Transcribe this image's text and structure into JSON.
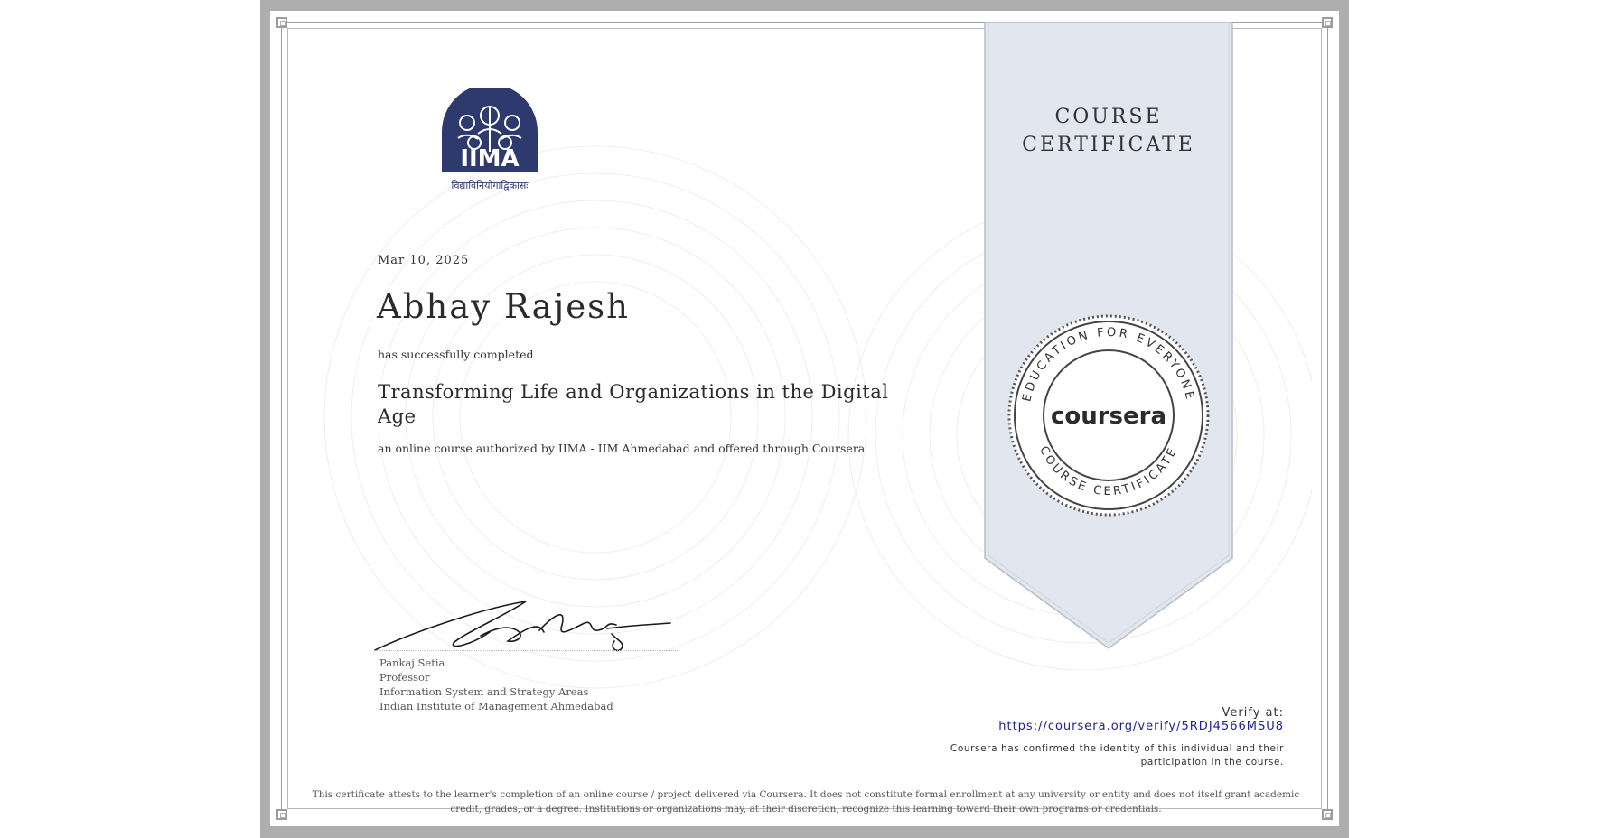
{
  "certificate": {
    "date": "Mar 10, 2025",
    "recipient_name": "Abhay Rajesh",
    "completion_text": "has successfully completed",
    "course_title": "Transforming Life and Organizations in the Digital Age",
    "authorization_text": "an online course authorized by IIMA - IIM Ahmedabad and offered through Coursera"
  },
  "logo": {
    "name": "IIMA",
    "motto": "विद्याविनियोगाद्विकासः",
    "color": "#2e3a6e"
  },
  "ribbon": {
    "title_line1": "COURSE",
    "title_line2": "CERTIFICATE",
    "color": "#e2e6ee"
  },
  "seal": {
    "brand": "coursera",
    "ring_top_text": "EDUCATION FOR EVERYONE",
    "ring_bottom_text": "COURSE CERTIFICATE"
  },
  "signatory": {
    "name": "Pankaj Setia",
    "title": "Professor",
    "department": "Information System and Strategy Areas",
    "institution": "Indian Institute of Management Ahmedabad"
  },
  "verification": {
    "label": "Verify at:",
    "url": "https://coursera.org/verify/5RDJ4566MSU8",
    "identity_note": "Coursera has confirmed the identity of this individual and their participation in the course."
  },
  "disclaimer": "This certificate attests to the learner's completion of an online course / project delivered via Coursera. It does not constitute formal enrollment at any university or entity and does not itself grant academic credit, grades, or a degree. Institutions or organizations may, at their discretion, recognize this learning toward their own programs or credentials.",
  "colors": {
    "frame": "#aeaeae",
    "link": "#1f1f8f"
  }
}
